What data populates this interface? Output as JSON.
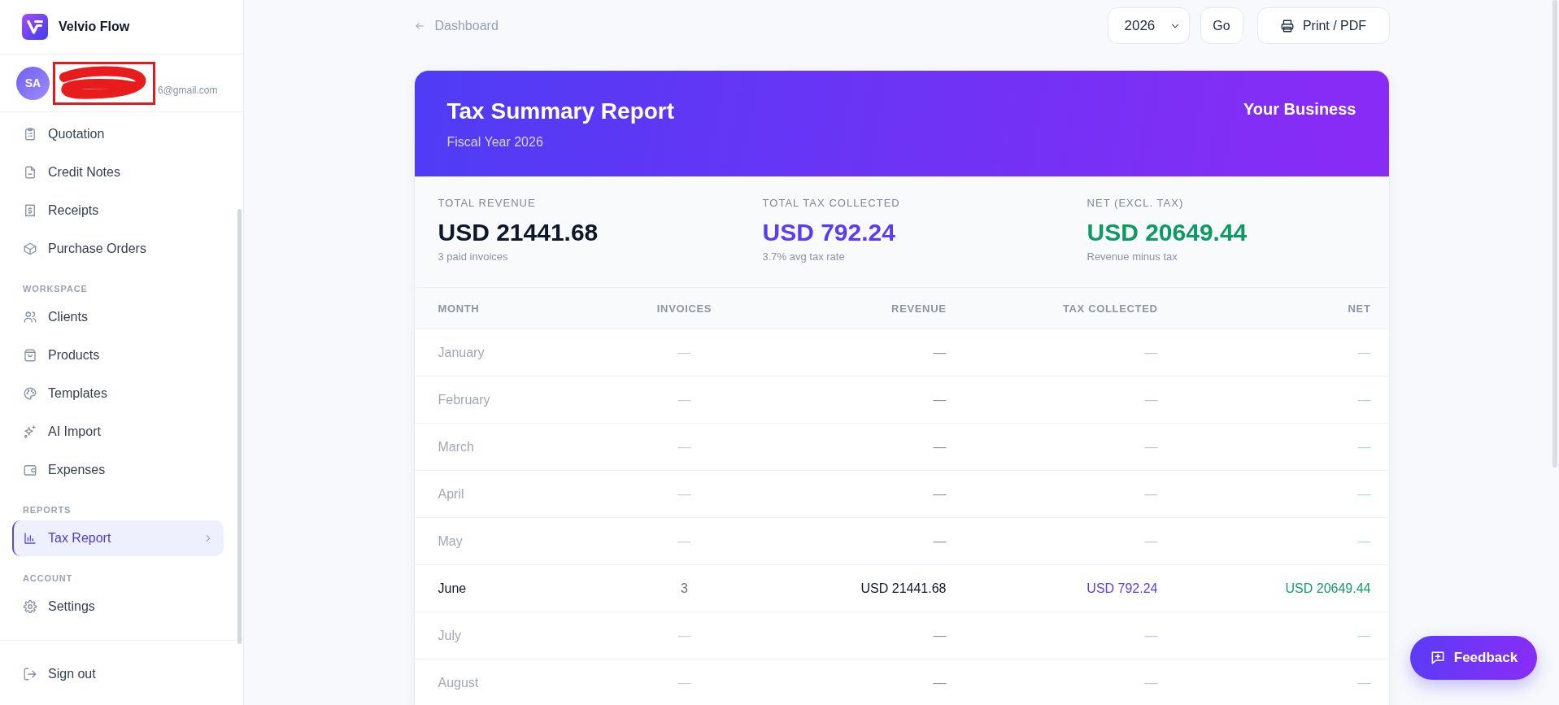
{
  "app": {
    "name": "Velvio Flow"
  },
  "user": {
    "initials": "SA",
    "email": "6@gmail.com",
    "redacted": true
  },
  "sidebar": {
    "sections": [
      {
        "items": [
          {
            "label": "Quotation",
            "selected": false
          },
          {
            "label": "Credit Notes",
            "selected": false
          },
          {
            "label": "Receipts",
            "selected": false
          },
          {
            "label": "Purchase Orders",
            "selected": false
          }
        ]
      },
      {
        "title": "WORKSPACE",
        "items": [
          {
            "label": "Clients",
            "selected": false
          },
          {
            "label": "Products",
            "selected": false
          },
          {
            "label": "Templates",
            "selected": false
          },
          {
            "label": "AI Import",
            "selected": false
          },
          {
            "label": "Expenses",
            "selected": false
          }
        ]
      },
      {
        "title": "REPORTS",
        "items": [
          {
            "label": "Tax Report",
            "selected": true
          }
        ]
      },
      {
        "title": "ACCOUNT",
        "items": [
          {
            "label": "Settings",
            "selected": false
          }
        ]
      }
    ],
    "sign_out": "Sign out"
  },
  "toolbar": {
    "back_link": "Dashboard",
    "year_select": {
      "value": "2026"
    },
    "go_button": "Go",
    "print_button": "Print / PDF"
  },
  "report": {
    "title": "Tax Summary Report",
    "subtitle": "Fiscal Year 2026",
    "business": "Your Business",
    "summary": [
      {
        "label": "TOTAL REVENUE",
        "value": "USD 21441.68",
        "note": "3 paid invoices",
        "color": "#0f172a"
      },
      {
        "label": "TOTAL TAX COLLECTED",
        "value": "USD 792.24",
        "note": "3.7% avg tax rate",
        "color": "#5b3cf5"
      },
      {
        "label": "NET (EXCL. TAX)",
        "value": "USD 20649.44",
        "note": "Revenue minus tax",
        "color": "#0e9a63"
      }
    ],
    "table": {
      "columns": [
        {
          "label": "MONTH",
          "kind": "month"
        },
        {
          "label": "INVOICES",
          "kind": "count"
        },
        {
          "label": "REVENUE",
          "kind": "revenue"
        },
        {
          "label": "TAX COLLECTED",
          "kind": "tax"
        },
        {
          "label": "NET",
          "kind": "net"
        }
      ],
      "rows": [
        {
          "cells": [
            "January",
            "—",
            "—",
            "—",
            "—"
          ],
          "muted": true
        },
        {
          "cells": [
            "February",
            "—",
            "—",
            "—",
            "—"
          ],
          "muted": true
        },
        {
          "cells": [
            "March",
            "—",
            "—",
            "—",
            "—"
          ],
          "muted": true
        },
        {
          "cells": [
            "April",
            "—",
            "—",
            "—",
            "—"
          ],
          "muted": true
        },
        {
          "cells": [
            "May",
            "—",
            "—",
            "—",
            "—"
          ],
          "muted": true
        },
        {
          "cells": [
            "June",
            "3",
            "USD 21441.68",
            "USD 792.24",
            "USD 20649.44"
          ],
          "muted": false
        },
        {
          "cells": [
            "July",
            "—",
            "—",
            "—",
            "—"
          ],
          "muted": true
        },
        {
          "cells": [
            "August",
            "—",
            "—",
            "—",
            "—"
          ],
          "muted": true
        }
      ]
    }
  },
  "feedback_button": "Feedback"
}
